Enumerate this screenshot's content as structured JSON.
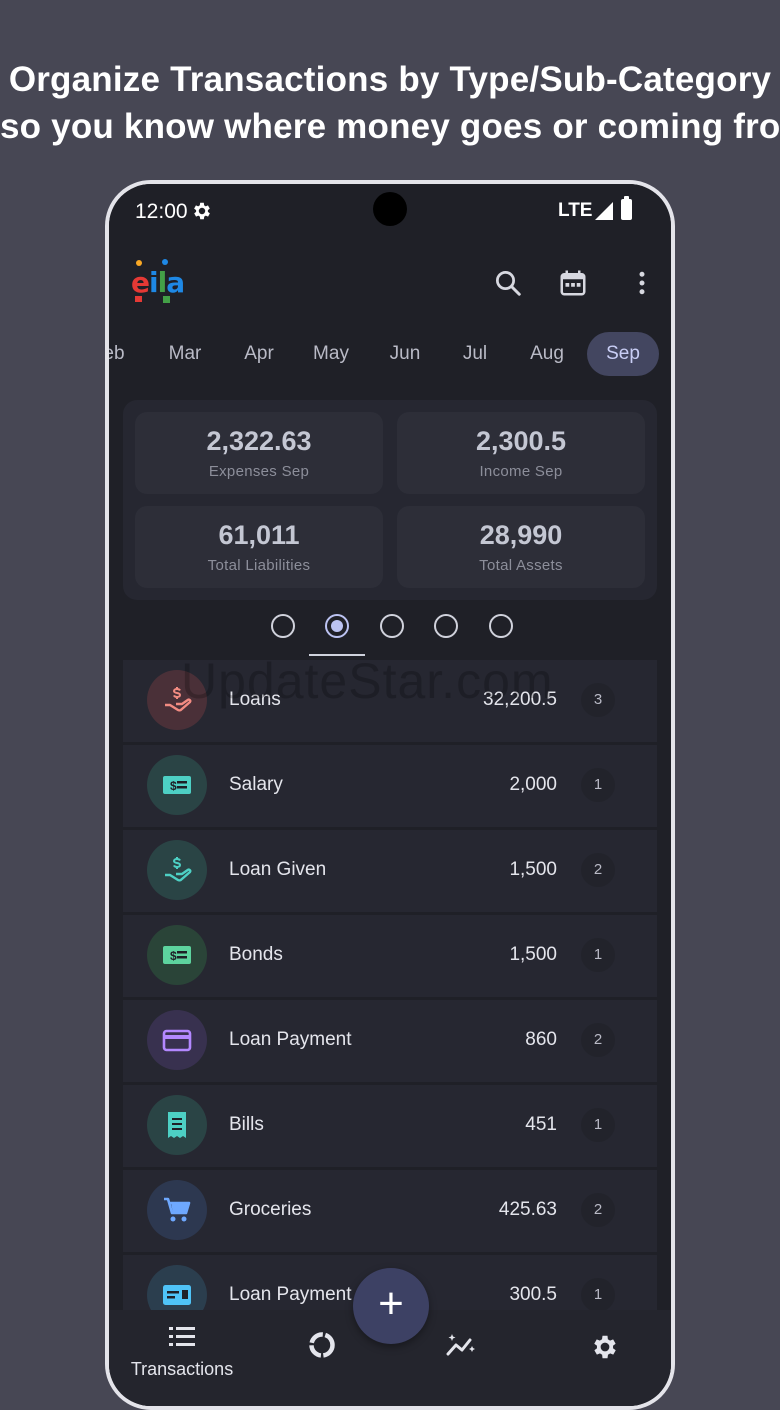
{
  "headline": {
    "line1": "Organize Transactions by Type/Sub-Category",
    "line2": "so you know where money goes or coming from"
  },
  "status_bar": {
    "time": "12:00",
    "network": "LTE"
  },
  "app": {
    "logo_text": "eila"
  },
  "months": [
    "eb",
    "Mar",
    "Apr",
    "May",
    "Jun",
    "Jul",
    "Aug",
    "Sep"
  ],
  "selected_month": "Sep",
  "summary": {
    "expenses": {
      "value": "2,322.63",
      "label": "Expenses Sep"
    },
    "income": {
      "value": "2,300.5",
      "label": "Income Sep"
    },
    "liabilities": {
      "value": "61,011",
      "label": "Total Liabilities"
    },
    "assets": {
      "value": "28,990",
      "label": "Total Assets"
    }
  },
  "page_indicator": {
    "count": 5,
    "active_index": 1
  },
  "watermark": "UpdateStar.com",
  "categories": [
    {
      "label": "Loans",
      "amount": "32,200.5",
      "count": "3",
      "icon": "hand-dollar-icon",
      "color": "#f28b82",
      "bg": "#4a3038"
    },
    {
      "label": "Salary",
      "amount": "2,000",
      "count": "1",
      "icon": "money-bill-icon",
      "color": "#4dd0c4",
      "bg": "#2a4445"
    },
    {
      "label": "Loan Given",
      "amount": "1,500",
      "count": "2",
      "icon": "hand-dollar-icon",
      "color": "#4dd0c4",
      "bg": "#2a4445"
    },
    {
      "label": "Bonds",
      "amount": "1,500",
      "count": "1",
      "icon": "money-bill-icon",
      "color": "#5dd39e",
      "bg": "#2a4438"
    },
    {
      "label": "Loan Payment",
      "amount": "860",
      "count": "2",
      "icon": "credit-card-icon",
      "color": "#b388ff",
      "bg": "#38314f"
    },
    {
      "label": "Bills",
      "amount": "451",
      "count": "1",
      "icon": "receipt-icon",
      "color": "#4dd0c4",
      "bg": "#2a4445"
    },
    {
      "label": "Groceries",
      "amount": "425.63",
      "count": "2",
      "icon": "cart-icon",
      "color": "#6ea8fe",
      "bg": "#2d3850"
    },
    {
      "label": "Loan Payment",
      "amount": "300.5",
      "count": "1",
      "icon": "id-card-icon",
      "color": "#4fc3f7",
      "bg": "#2b3e4e"
    }
  ],
  "bottom_nav": {
    "transactions_label": "Transactions",
    "fab_label": "+"
  }
}
